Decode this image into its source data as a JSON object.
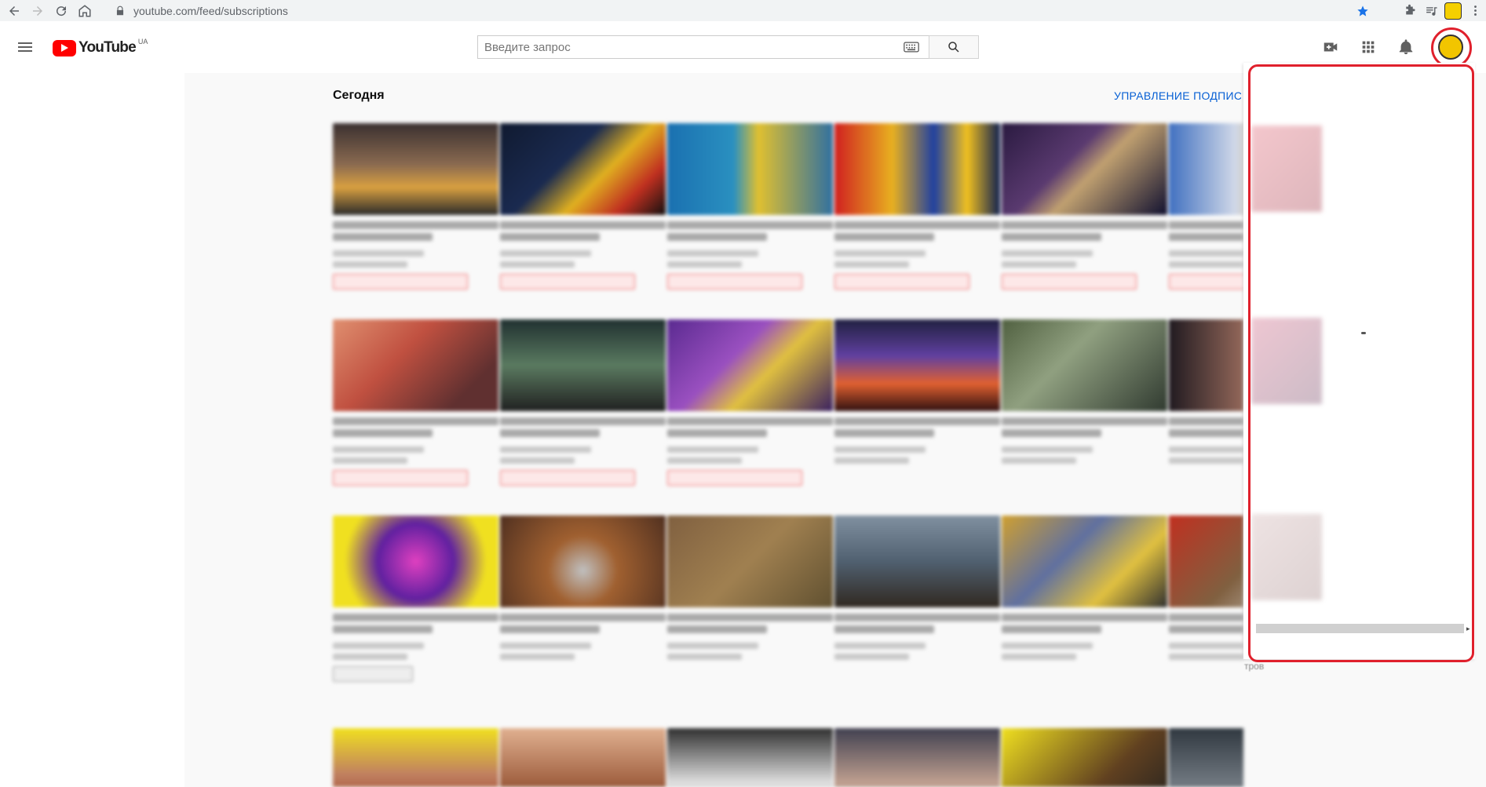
{
  "browser": {
    "url": "youtube.com/feed/subscriptions"
  },
  "header": {
    "logo_text": "YouTube",
    "region": "UA",
    "search_placeholder": "Введите запрос"
  },
  "main": {
    "section_title": "Сегодня",
    "manage_link": "УПРАВЛЕНИЕ ПОДПИСК"
  },
  "colors": {
    "accent_red": "#e0202c",
    "link_blue": "#065fd4",
    "yt_red": "#ff0000"
  },
  "panel": {
    "tail_text": "тров"
  }
}
